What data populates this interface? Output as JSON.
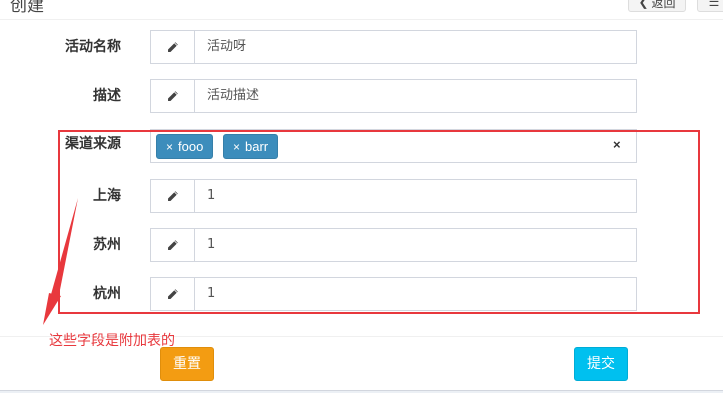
{
  "header": {
    "title": "创建",
    "back_label": "返回",
    "list_label": "☰"
  },
  "form": {
    "name": {
      "label": "活动名称",
      "value": "活动呀"
    },
    "description": {
      "label": "描述",
      "value": "活动描述"
    },
    "channel": {
      "label": "渠道来源",
      "tags": [
        "fooo",
        "barr"
      ],
      "clear": "×"
    },
    "shanghai": {
      "label": "上海",
      "value": "1"
    },
    "suzhou": {
      "label": "苏州",
      "value": "1"
    },
    "hangzhou": {
      "label": "杭州",
      "value": "1"
    }
  },
  "annotation": {
    "text": "这些字段是附加表的",
    "color": "#e8383d"
  },
  "footer": {
    "reset_label": "重置",
    "submit_label": "提交"
  },
  "colors": {
    "tag": "#3c8dbc",
    "reset": "#f39c12",
    "submit": "#00c0ef"
  }
}
